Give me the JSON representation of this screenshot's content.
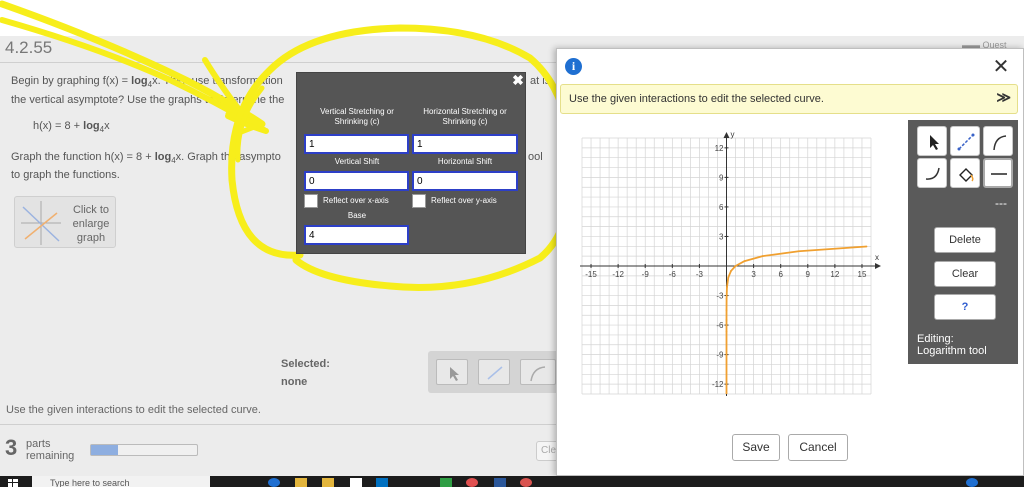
{
  "page": {
    "problem_number": "4.2.55",
    "question_line1_prefix": "Begin by graphing f(x) = ",
    "question_line1_func": "log",
    "question_line1_sub": "4",
    "question_line1_suffix": "x. Then use transformation",
    "question_line1_tail": "at is",
    "question_line2": "the vertical asymptote? Use the graphs to determine the",
    "h_func_prefix": "h(x) = 8 + ",
    "h_func_log": "log",
    "h_func_sub": "4",
    "h_func_suffix": "x",
    "graph_instr_prefix": "Graph the function h(x) = 8 + ",
    "graph_instr_log": "log",
    "graph_instr_sub": "4",
    "graph_instr_suffix": "x. Graph  the asympto",
    "graph_instr_tail": "ool",
    "graph_instr_line2": "to graph the functions.",
    "enlarge_label": "Click to enlarge graph",
    "selected_label": "Selected:",
    "selected_value": "none",
    "footer_instruction": "Use the given interactions to edit the selected curve.",
    "parts_count": "3",
    "parts_label_1": "parts",
    "parts_label_2": "remaining",
    "progress_fraction": 0.25,
    "clear_label": "Cle"
  },
  "popup": {
    "vertical_stretch_label": "Vertical Stretching or Shrinking (c)",
    "vertical_stretch_value": "1",
    "horizontal_stretch_label": "Horizontal Stretching or Shrinking (c)",
    "horizontal_stretch_value": "1",
    "vertical_shift_label": "Vertical Shift",
    "vertical_shift_value": "0",
    "horizontal_shift_label": "Horizontal Shift",
    "horizontal_shift_value": "0",
    "reflect_x_label": "Reflect over x-axis",
    "reflect_y_label": "Reflect over y-axis",
    "base_label": "Base",
    "base_value": "4",
    "close_glyph": "✖"
  },
  "dialog": {
    "info_glyph": "i",
    "close_glyph": "✕",
    "instruction": "Use the given interactions to edit the selected curve.",
    "expand_glyph": "≫",
    "delete_label": "Delete",
    "clear_label": "Clear",
    "help_label": "?",
    "dash_label": "---",
    "editing_line1": "Editing:",
    "editing_line2": "Logarithm tool",
    "save_label": "Save",
    "cancel_label": "Cancel"
  },
  "taskbar": {
    "search_placeholder": "Type here to search"
  },
  "chart_data": {
    "type": "line",
    "x_axis_label": "x",
    "y_axis_label": "y",
    "xlim": [
      -16,
      16
    ],
    "ylim": [
      -13,
      13
    ],
    "x_ticks": [
      -15,
      -12,
      -9,
      -6,
      -3,
      3,
      6,
      9,
      12,
      15
    ],
    "y_ticks": [
      -12,
      -9,
      -6,
      -3,
      3,
      6,
      9,
      12
    ],
    "grid": true,
    "series": [
      {
        "function": "log base 4 of x",
        "color": "#f0a030",
        "x": [
          0.0001,
          0.0005,
          0.002,
          0.01,
          0.05,
          0.2,
          0.5,
          1,
          2,
          4,
          8,
          15.5
        ],
        "y": [
          -6.64,
          -5.48,
          -4.48,
          -3.32,
          -2.16,
          -1.16,
          -0.5,
          0,
          0.5,
          1,
          1.5,
          1.98
        ]
      }
    ]
  }
}
